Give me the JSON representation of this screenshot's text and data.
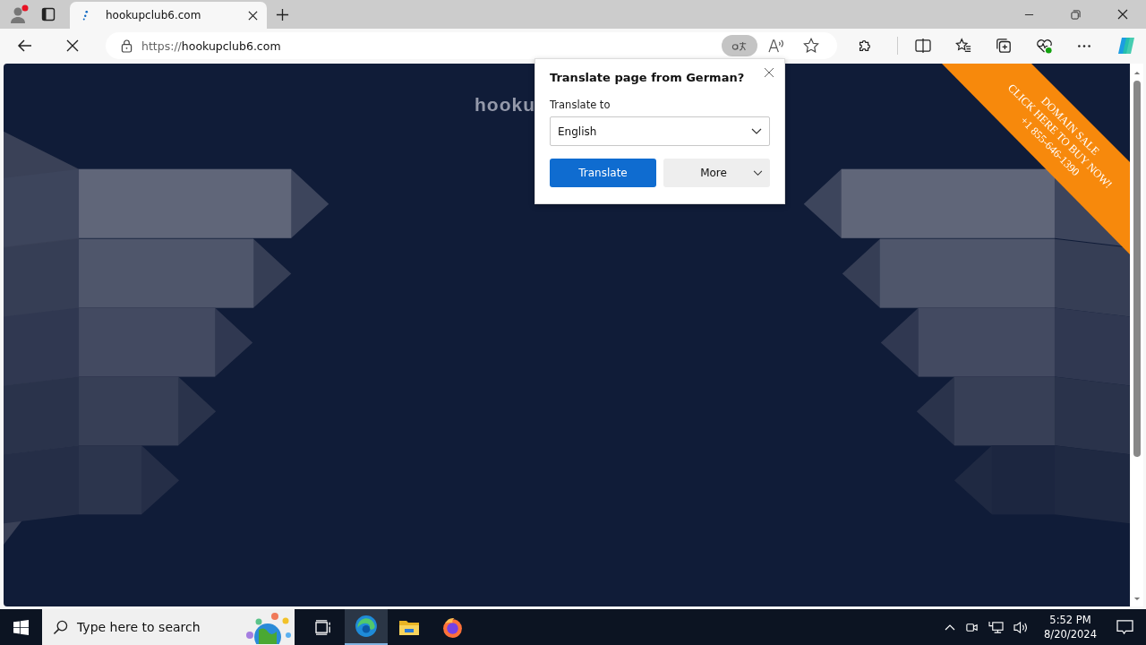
{
  "browser": {
    "loading": true,
    "tabs": [
      {
        "title": "hookupclub6.com",
        "selected": true
      }
    ],
    "address": {
      "scheme": "https://",
      "host": "hookupclub6.com"
    }
  },
  "page": {
    "heading": "hooku",
    "ribbon": [
      "DOMAIN SALE",
      "CLICK HERE TO BUY NOW!",
      "+1 855-646-1390"
    ]
  },
  "translate_popup": {
    "title": "Translate page from  German?",
    "label": "Translate to",
    "language": "English",
    "primary_button": "Translate",
    "secondary_button": "More"
  },
  "taskbar": {
    "search_placeholder": "Type here to search",
    "apps": [
      {
        "kind": "task-view",
        "selected": false
      },
      {
        "kind": "edge",
        "selected": true
      },
      {
        "kind": "files",
        "selected": false
      },
      {
        "kind": "firefox",
        "selected": false
      }
    ],
    "time": "5:52 PM",
    "date": "8/20/2024"
  }
}
